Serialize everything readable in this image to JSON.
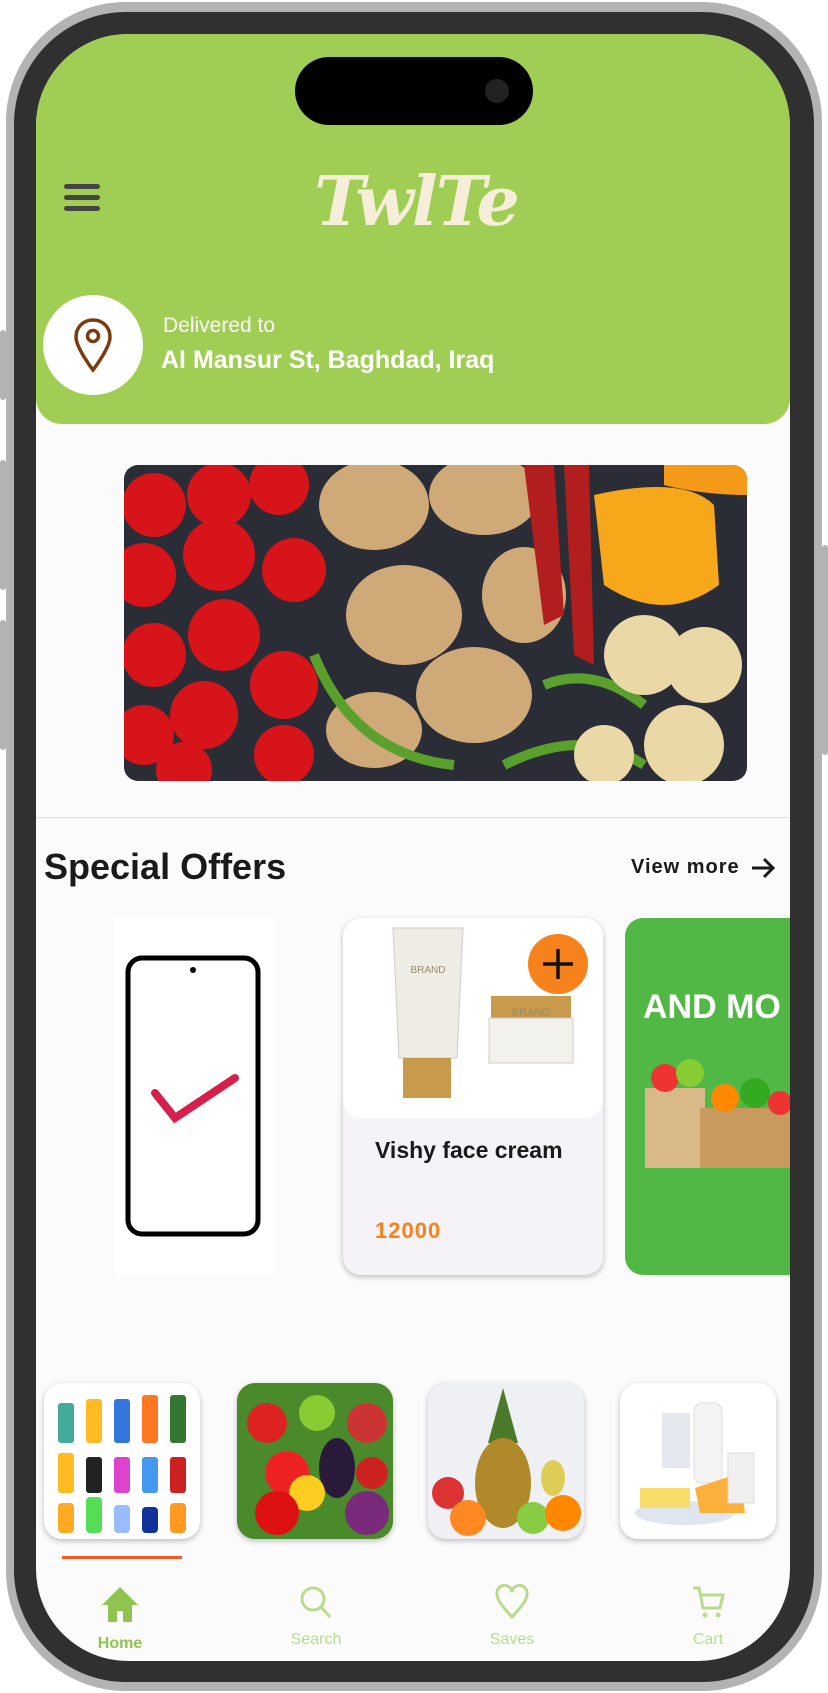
{
  "app": {
    "logo_text": "Twlte"
  },
  "header": {
    "menu_icon": "hamburger-icon",
    "delivered_label": "Delivered to",
    "address": "Al Mansur St, Baghdad, Iraq",
    "location_icon": "map-pin-icon"
  },
  "colors": {
    "header": "#a0ce55",
    "accent": "#f7821b",
    "nav_active": "#8fc44f",
    "nav_inactive": "#b9dc8c",
    "category_indicator": "#f25c2a"
  },
  "special_offers": {
    "title": "Special Offers",
    "view_more": "View more",
    "product": {
      "name": "Vishy face cream",
      "price": "12000",
      "brand_label": "BRAND"
    },
    "promo_text": "AND MO"
  },
  "categories": [
    {
      "image": "soft-drinks"
    },
    {
      "image": "vegetables"
    },
    {
      "image": "fruits"
    },
    {
      "image": "dairy"
    }
  ],
  "nav": {
    "items": [
      {
        "label": "Home",
        "icon": "home-icon",
        "active": true
      },
      {
        "label": "Search",
        "icon": "search-icon"
      },
      {
        "label": "Saves",
        "icon": "heart-icon"
      },
      {
        "label": "Cart",
        "icon": "cart-icon"
      }
    ]
  }
}
